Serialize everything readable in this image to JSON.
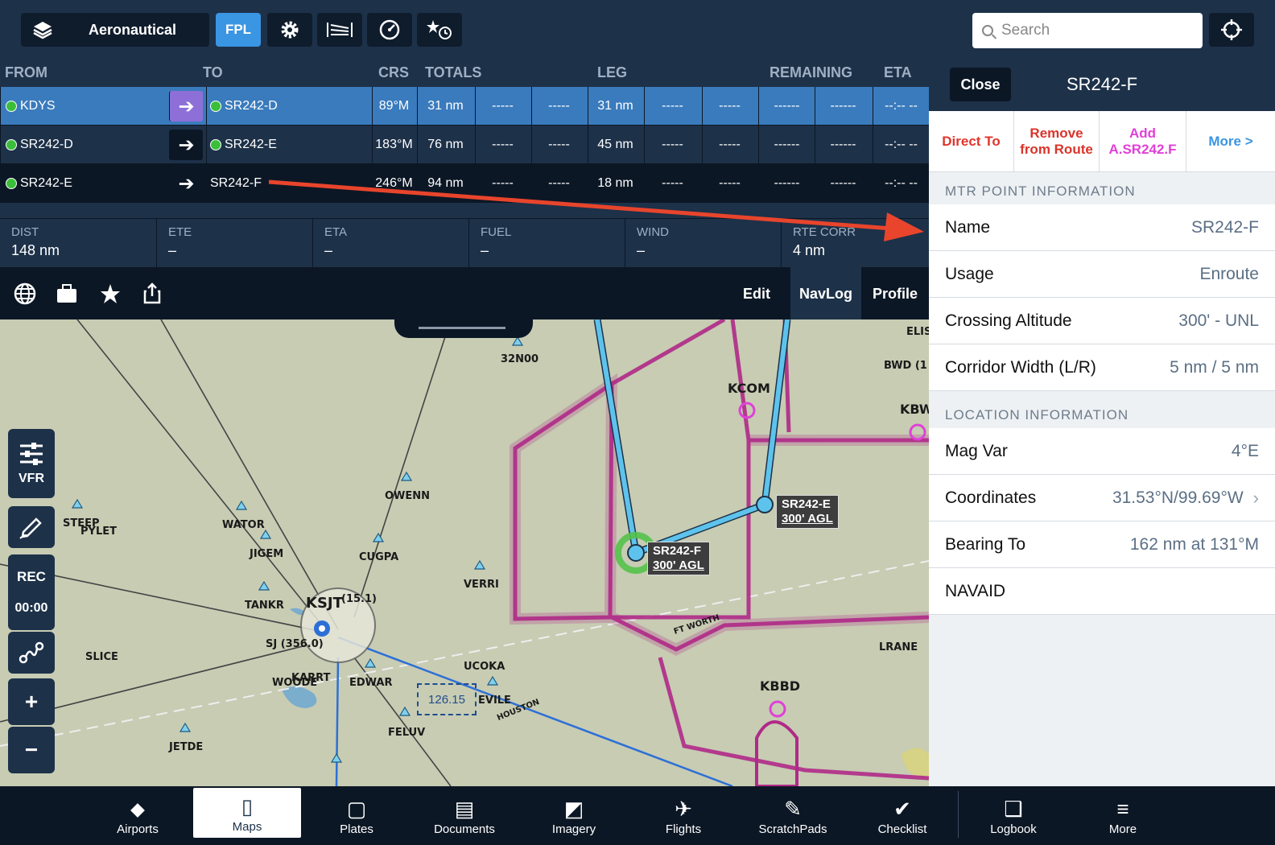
{
  "topbar": {
    "layers_label": "Aeronautical",
    "fpl_label": "FPL",
    "search_placeholder": "Search"
  },
  "fpl": {
    "headers": [
      "FROM",
      "TO",
      "CRS",
      "TOTALS",
      "LEG",
      "REMAINING",
      "ETA"
    ],
    "rows": [
      {
        "from": "KDYS",
        "to": "SR242-D",
        "crs": "89°M",
        "total": "31 nm",
        "c1": "-----",
        "c2": "-----",
        "leg": "31 nm",
        "c3": "-----",
        "c4": "-----",
        "r1": "------",
        "r2": "------",
        "eta": "--:-- --",
        "from_dot": true,
        "to_dot": true
      },
      {
        "from": "SR242-D",
        "to": "SR242-E",
        "crs": "183°M",
        "total": "76 nm",
        "c1": "-----",
        "c2": "-----",
        "leg": "45 nm",
        "c3": "-----",
        "c4": "-----",
        "r1": "------",
        "r2": "------",
        "eta": "--:-- --",
        "from_dot": true,
        "to_dot": true
      },
      {
        "from": "SR242-E",
        "to": "SR242-F",
        "crs": "246°M",
        "total": "94 nm",
        "c1": "-----",
        "c2": "-----",
        "leg": "18 nm",
        "c3": "-----",
        "c4": "-----",
        "r1": "------",
        "r2": "------",
        "eta": "--:-- --",
        "from_dot": true,
        "to_dot": false
      }
    ],
    "stats": [
      {
        "k": "DIST",
        "v": "148 nm"
      },
      {
        "k": "ETE",
        "v": "–"
      },
      {
        "k": "ETA",
        "v": "–"
      },
      {
        "k": "FUEL",
        "v": "–"
      },
      {
        "k": "WIND",
        "v": "–"
      },
      {
        "k": "RTE CORR",
        "v": "4 nm"
      }
    ],
    "tabs": {
      "edit": "Edit",
      "navlog": "NavLog",
      "profile": "Profile"
    }
  },
  "map": {
    "controls": {
      "vfr": "VFR",
      "rec": "REC",
      "timer": "00:00",
      "zoom_in": "+",
      "zoom_out": "−"
    },
    "labels": [
      {
        "t": "32N00"
      },
      {
        "t": "ELIS"
      },
      {
        "t": "BWD (1"
      },
      {
        "t": "KCOM"
      },
      {
        "t": "KBW"
      },
      {
        "t": "OWENN"
      },
      {
        "t": "STEEP"
      },
      {
        "t": "PYLET"
      },
      {
        "t": "WATOR"
      },
      {
        "t": "JIGEM"
      },
      {
        "t": "CUGPA"
      },
      {
        "t": "VERRI"
      },
      {
        "t": "TANKR"
      },
      {
        "t": "KSJT"
      },
      {
        "t": "(15.1)"
      },
      {
        "t": "SJ (356.0)"
      },
      {
        "t": "SLICE"
      },
      {
        "t": "WOODE"
      },
      {
        "t": "KARRT"
      },
      {
        "t": "EDWAR"
      },
      {
        "t": "UCOKA"
      },
      {
        "t": "EVILE"
      },
      {
        "t": "FELUV"
      },
      {
        "t": "JETDE"
      },
      {
        "t": "LRANE"
      },
      {
        "t": "KBBD"
      },
      {
        "t": "FT WORTH"
      },
      {
        "t": "HOUSTON"
      }
    ],
    "freq": "126.15",
    "tag_e": {
      "name": "SR242-E",
      "alt": "300' AGL"
    },
    "tag_f": {
      "name": "SR242-F",
      "alt": "300' AGL"
    }
  },
  "panel": {
    "close_label": "Close",
    "title": "SR242-F",
    "actions": {
      "direct": "Direct To",
      "remove": "Remove from Route",
      "add": "Add A.SR242.F",
      "more": "More >"
    },
    "section_mtr": "MTR POINT INFORMATION",
    "mtr_rows": [
      {
        "k": "Name",
        "v": "SR242-F"
      },
      {
        "k": "Usage",
        "v": "Enroute"
      },
      {
        "k": "Crossing Altitude",
        "v": "300' - UNL"
      },
      {
        "k": "Corridor Width (L/R)",
        "v": "5 nm / 5 nm"
      }
    ],
    "section_loc": "LOCATION INFORMATION",
    "loc_rows": [
      {
        "k": "Mag Var",
        "v": "4°E"
      },
      {
        "k": "Coordinates",
        "v": "31.53°N/99.69°W"
      },
      {
        "k": "Bearing To",
        "v": "162 nm at 131°M"
      },
      {
        "k": "NAVAID",
        "v": ""
      }
    ],
    "colors": {
      "direct": "#e0352b",
      "remove": "#d9342b",
      "add": "#e040d8",
      "more": "#3a95e3"
    }
  },
  "tabbar": [
    {
      "label": "Airports",
      "icon": "airports-icon"
    },
    {
      "label": "Maps",
      "icon": "maps-icon"
    },
    {
      "label": "Plates",
      "icon": "plates-icon"
    },
    {
      "label": "Documents",
      "icon": "documents-icon"
    },
    {
      "label": "Imagery",
      "icon": "imagery-icon"
    },
    {
      "label": "Flights",
      "icon": "flights-icon"
    },
    {
      "label": "ScratchPads",
      "icon": "scratchpads-icon"
    },
    {
      "label": "Checklist",
      "icon": "checklist-icon"
    },
    {
      "label": "Logbook",
      "icon": "logbook-icon"
    },
    {
      "label": "More",
      "icon": "more-icon"
    }
  ]
}
